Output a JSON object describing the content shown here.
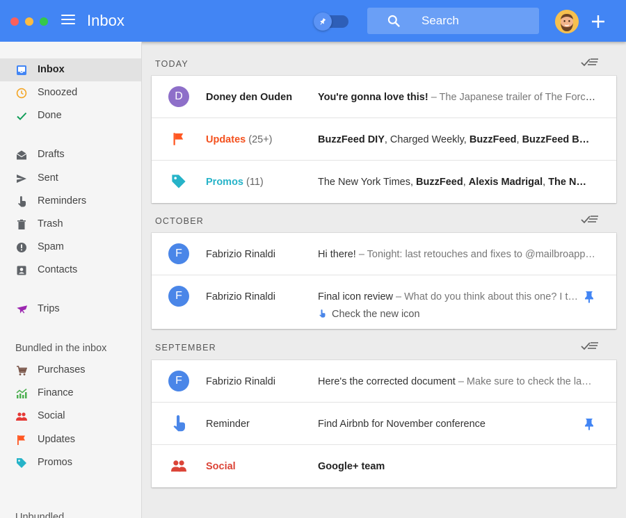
{
  "window": {
    "title": "Inbox"
  },
  "search": {
    "placeholder": "Search"
  },
  "sidebar": {
    "primary": [
      {
        "label": "Inbox",
        "icon": "inbox-icon",
        "color": "#4285f4",
        "active": true
      },
      {
        "label": "Snoozed",
        "icon": "clock-icon",
        "color": "#f4a523"
      },
      {
        "label": "Done",
        "icon": "check-icon",
        "color": "#0f9d58"
      }
    ],
    "secondary": [
      {
        "label": "Drafts",
        "icon": "drafts-icon"
      },
      {
        "label": "Sent",
        "icon": "send-icon"
      },
      {
        "label": "Reminders",
        "icon": "reminder-hand-icon"
      },
      {
        "label": "Trash",
        "icon": "trash-icon"
      },
      {
        "label": "Spam",
        "icon": "spam-icon"
      },
      {
        "label": "Contacts",
        "icon": "contacts-icon"
      }
    ],
    "trips": {
      "label": "Trips",
      "icon": "airplane-icon",
      "color": "#9c27b0"
    },
    "bundled_title": "Bundled in the inbox",
    "bundles": [
      {
        "label": "Purchases",
        "icon": "cart-icon",
        "color": "#795548"
      },
      {
        "label": "Finance",
        "icon": "finance-icon",
        "color": "#4caf50"
      },
      {
        "label": "Social",
        "icon": "social-icon",
        "color": "#e53935"
      },
      {
        "label": "Updates",
        "icon": "flag-icon",
        "color": "#ff5722"
      },
      {
        "label": "Promos",
        "icon": "tag-icon",
        "color": "#26b3c8"
      }
    ],
    "unbundled_title": "Unbundled"
  },
  "groups": [
    {
      "header": "TODAY",
      "rows": [
        {
          "avatar_letter": "D",
          "avatar_color": "#8e6fc9",
          "sender": "Doney den Ouden",
          "subject": "You're gonna love this!",
          "preview": " – The Japanese trailer of The Force…"
        },
        {
          "icon": "flag-icon",
          "icon_color": "#ff5722",
          "bundle": "Updates",
          "count": "(25+)",
          "parts": [
            {
              "text": "BuzzFeed DIY",
              "bold": true
            },
            {
              "text": ", Charged Weekly, "
            },
            {
              "text": "BuzzFeed",
              "bold": true
            },
            {
              "text": ", "
            },
            {
              "text": "BuzzFeed B…",
              "bold": true
            }
          ]
        },
        {
          "icon": "tag-icon",
          "icon_color": "#26b3c8",
          "bundle": "Promos",
          "count": "(11)",
          "parts": [
            {
              "text": "The New York Times, "
            },
            {
              "text": "BuzzFeed",
              "bold": true
            },
            {
              "text": ", "
            },
            {
              "text": "Alexis Madrigal",
              "bold": true
            },
            {
              "text": ", "
            },
            {
              "text": "The N…",
              "bold": true
            }
          ]
        }
      ]
    },
    {
      "header": "OCTOBER",
      "rows": [
        {
          "avatar_letter": "F",
          "avatar_color": "#4a86e8",
          "sender": "Fabrizio Rinaldi",
          "subject": "Hi there!",
          "preview": " – Tonight: last retouches and fixes to @mailbroapp…"
        },
        {
          "avatar_letter": "F",
          "avatar_color": "#4a86e8",
          "sender": "Fabrizio Rinaldi",
          "subject": "Final icon review",
          "preview": " – What do you think about this one? I t…",
          "pinned": true,
          "reminder": "Check the new icon"
        }
      ]
    },
    {
      "header": "SEPTEMBER",
      "rows": [
        {
          "avatar_letter": "F",
          "avatar_color": "#4a86e8",
          "sender": "Fabrizio Rinaldi",
          "subject": "Here's the corrected document",
          "preview": " – Make sure to check the la…"
        },
        {
          "icon": "reminder-hand-icon",
          "icon_color": "#4a86e8",
          "sender": "Reminder",
          "subject": "Find Airbnb for November conference",
          "pinned": true
        },
        {
          "icon": "social-icon",
          "icon_color": "#db4437",
          "bundle": "Social",
          "bold_subject": "Google+ team"
        }
      ]
    }
  ],
  "colors": {
    "accent": "#4285f4",
    "updates": "#f4511e",
    "promos": "#26b3c8",
    "social": "#db4437"
  }
}
